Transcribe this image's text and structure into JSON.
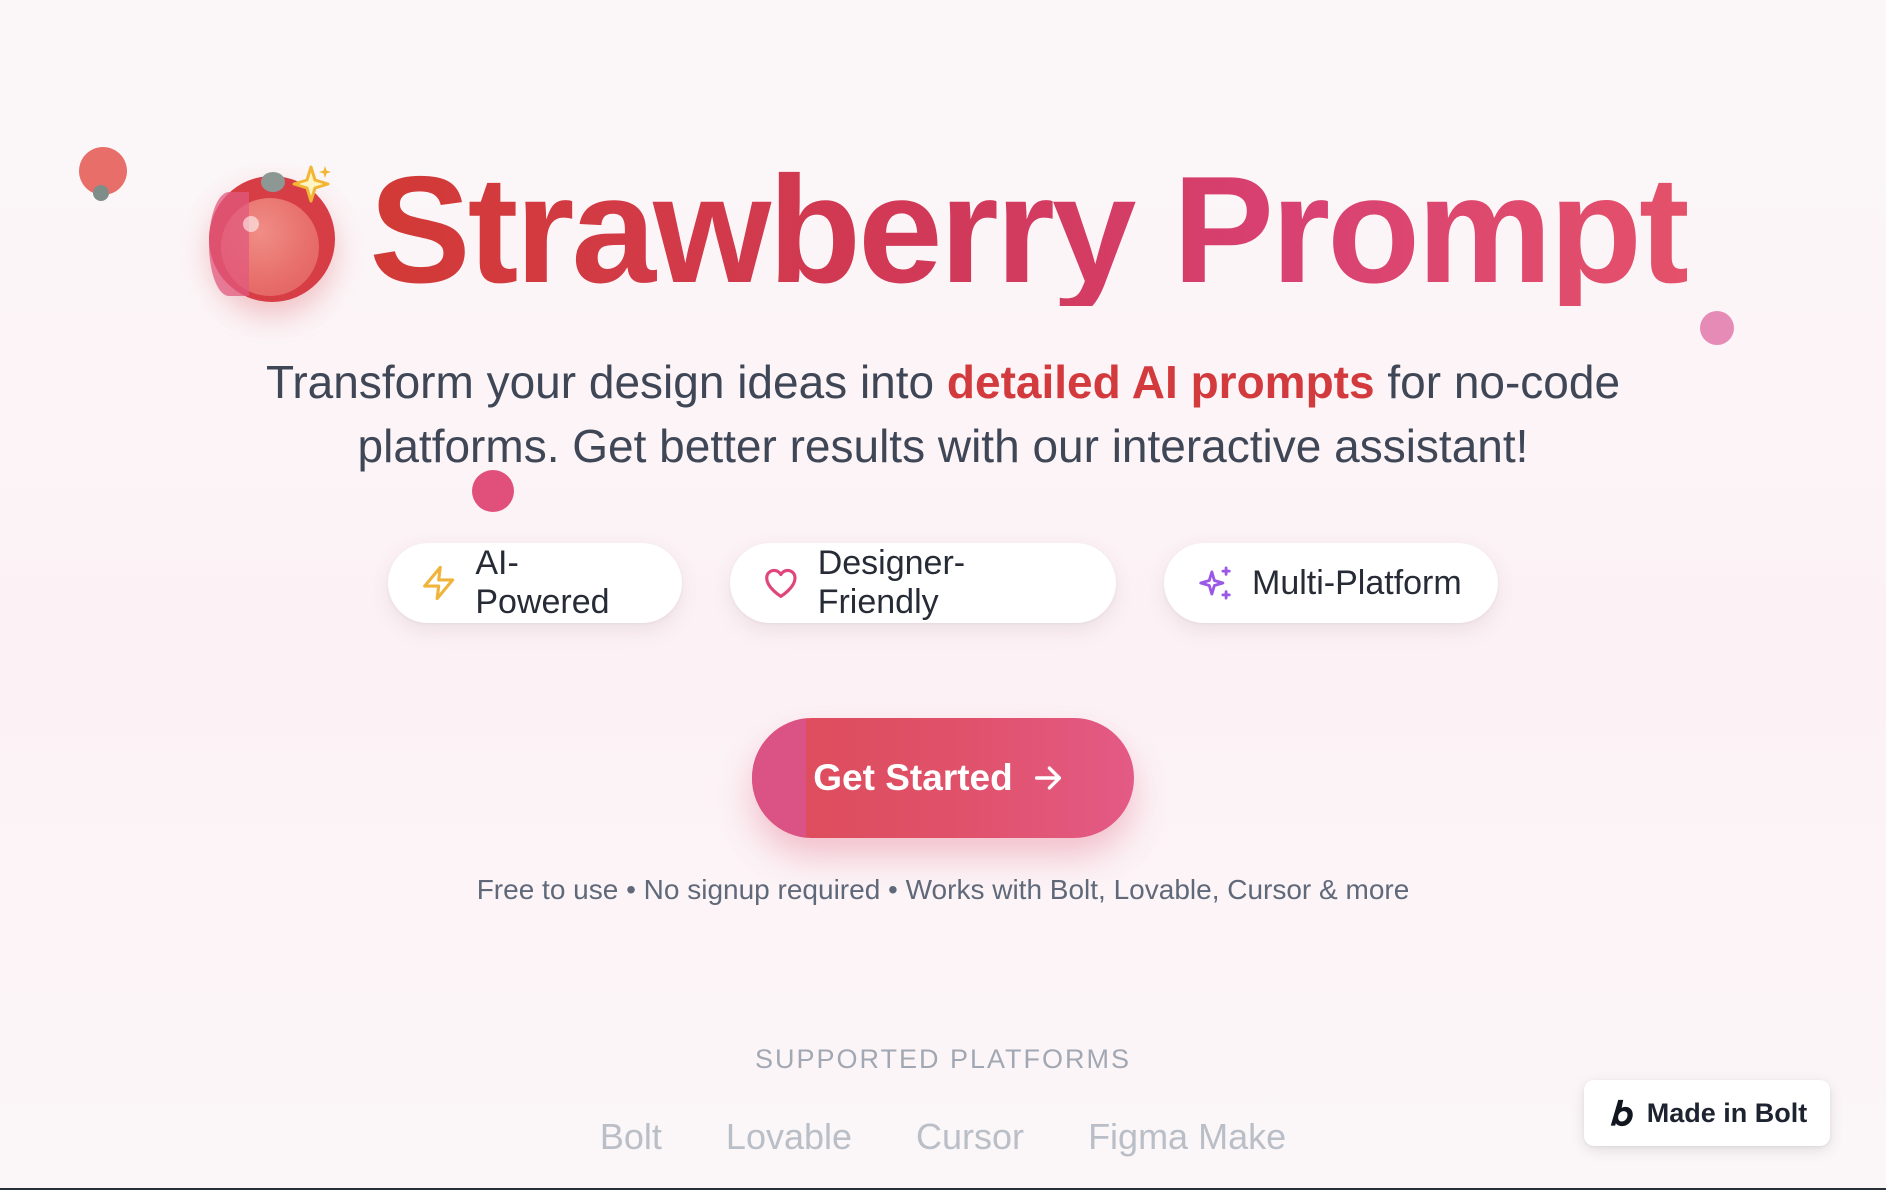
{
  "hero": {
    "title": "Strawberry Prompt",
    "subtitle_before": "Transform your design ideas into ",
    "subtitle_highlight": "detailed AI prompts",
    "subtitle_after": " for no-code platforms. Get better results with our interactive assistant!",
    "logo_icon": "strawberry-icon",
    "sparkle_icon": "sparkle-icon"
  },
  "features": [
    {
      "label": "AI-Powered",
      "icon": "lightning-icon"
    },
    {
      "label": "Designer-Friendly",
      "icon": "heart-icon"
    },
    {
      "label": "Multi-Platform",
      "icon": "sparkles-icon"
    }
  ],
  "cta": {
    "label": "Get Started",
    "icon": "arrow-right-icon"
  },
  "fine_print": "Free to use • No signup required • Works with Bolt, Lovable, Cursor & more",
  "platforms": {
    "heading": "SUPPORTED PLATFORMS",
    "items": [
      "Bolt",
      "Lovable",
      "Cursor",
      "Figma Make"
    ]
  },
  "badge": {
    "label": "Made in Bolt",
    "icon": "bolt-logo-icon"
  },
  "colors": {
    "brand_red": "#d23a36",
    "brand_pink": "#e0516a",
    "text": "#3f4757",
    "muted": "#b9bec7"
  }
}
